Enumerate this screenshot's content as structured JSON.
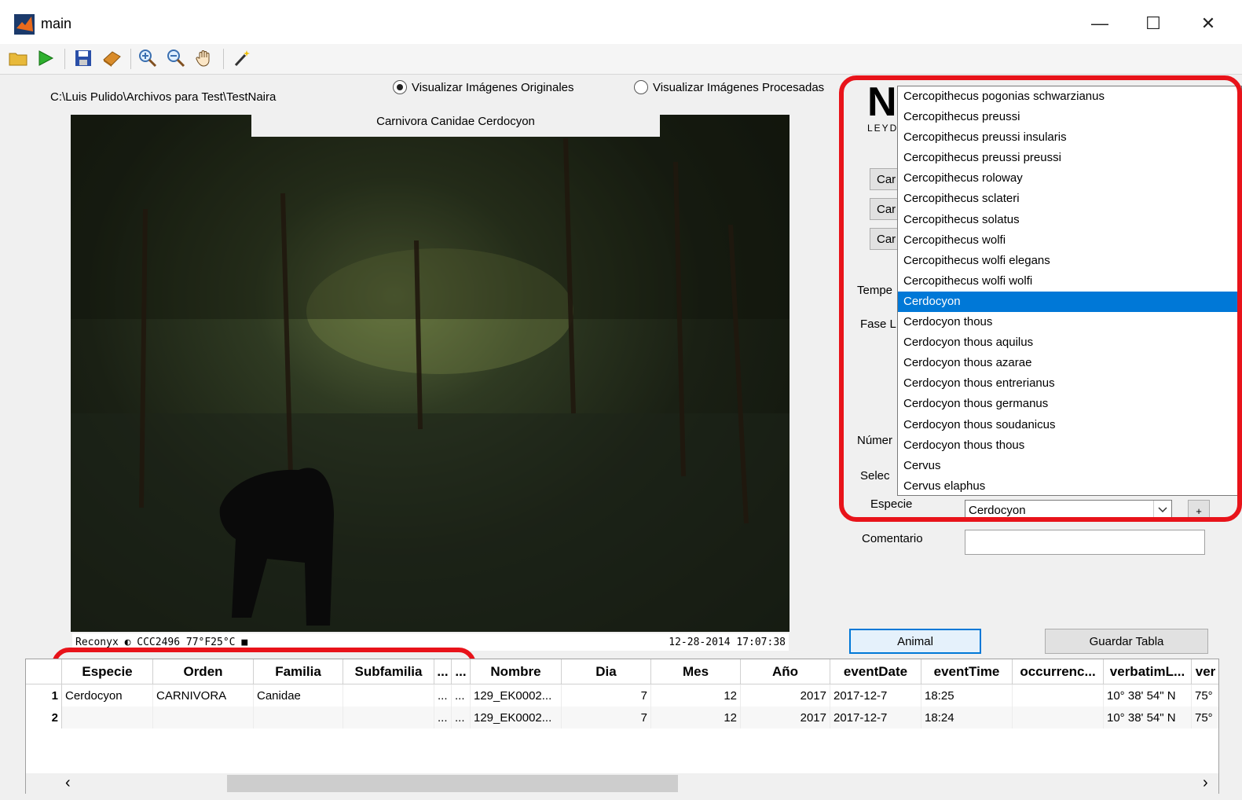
{
  "window": {
    "title": "main"
  },
  "toolbar": {
    "icons": [
      "open-folder-icon",
      "run-icon",
      "save-icon",
      "book-icon",
      "zoom-in-icon",
      "zoom-out-icon",
      "pan-hand-icon",
      "wand-icon"
    ]
  },
  "main": {
    "path": "C:\\Luis Pulido\\Archivos para Test\\TestNaira",
    "radio_original": "Visualizar Imágenes Originales",
    "radio_processed": "Visualizar Imágenes Procesadas",
    "radio_original_selected": true,
    "image_caption": "Carnivora Canidae Cerdocyon",
    "stamp_left": "Reconyx ◐ CCC2496  77°F25°C ■",
    "stamp_right": "12-28-2014  17:07:38"
  },
  "panel": {
    "logo_letter": "N",
    "logo_text": "LEYD",
    "side_buttons": [
      "Car",
      "Car",
      "Car"
    ],
    "label_tempe": "Tempe",
    "label_fase": "Fase L",
    "label_numero": "Númer",
    "label_selec": "Selec",
    "label_especie": "Especie",
    "especie_value": "Cerdocyon",
    "label_comentario": "Comentario",
    "comment_value": "",
    "plus_label": "+",
    "btn_animal": "Animal",
    "btn_guardar": "Guardar Tabla"
  },
  "dropdown": {
    "items": [
      "Cercopithecus  pogonias schwarzianus",
      "Cercopithecus  preussi",
      "Cercopithecus  preussi insularis",
      "Cercopithecus  preussi preussi",
      "Cercopithecus  roloway",
      "Cercopithecus  sclateri",
      "Cercopithecus  solatus",
      "Cercopithecus  wolfi",
      "Cercopithecus  wolfi elegans",
      "Cercopithecus  wolfi wolfi",
      "Cerdocyon",
      "Cerdocyon  thous",
      "Cerdocyon  thous aquilus",
      "Cerdocyon  thous azarae",
      "Cerdocyon  thous entrerianus",
      "Cerdocyon  thous germanus",
      "Cerdocyon  thous soudanicus",
      "Cerdocyon  thous thous",
      "Cervus",
      "Cervus  elaphus"
    ],
    "selected": "Cerdocyon"
  },
  "table": {
    "columns": [
      "Especie",
      "Orden",
      "Familia",
      "Subfamilia",
      "...",
      "...",
      "Nombre",
      "Dia",
      "Mes",
      "Año",
      "eventDate",
      "eventTime",
      "occurrenc...",
      "verbatimL...",
      "ver"
    ],
    "rows": [
      {
        "n": "1",
        "cells": [
          "Cerdocyon",
          "CARNIVORA",
          "Canidae",
          "",
          "...",
          "...",
          "129_EK0002...",
          "7",
          "12",
          "2017",
          "2017-12-7",
          "18:25",
          "",
          "10° 38' 54\" N",
          "75°"
        ]
      },
      {
        "n": "2",
        "cells": [
          "",
          "",
          "",
          "",
          "...",
          "...",
          "129_EK0002...",
          "7",
          "12",
          "2017",
          "2017-12-7",
          "18:24",
          "",
          "10° 38' 54\" N",
          "75°"
        ]
      }
    ],
    "scroll_left": "‹",
    "scroll_right": "›"
  }
}
